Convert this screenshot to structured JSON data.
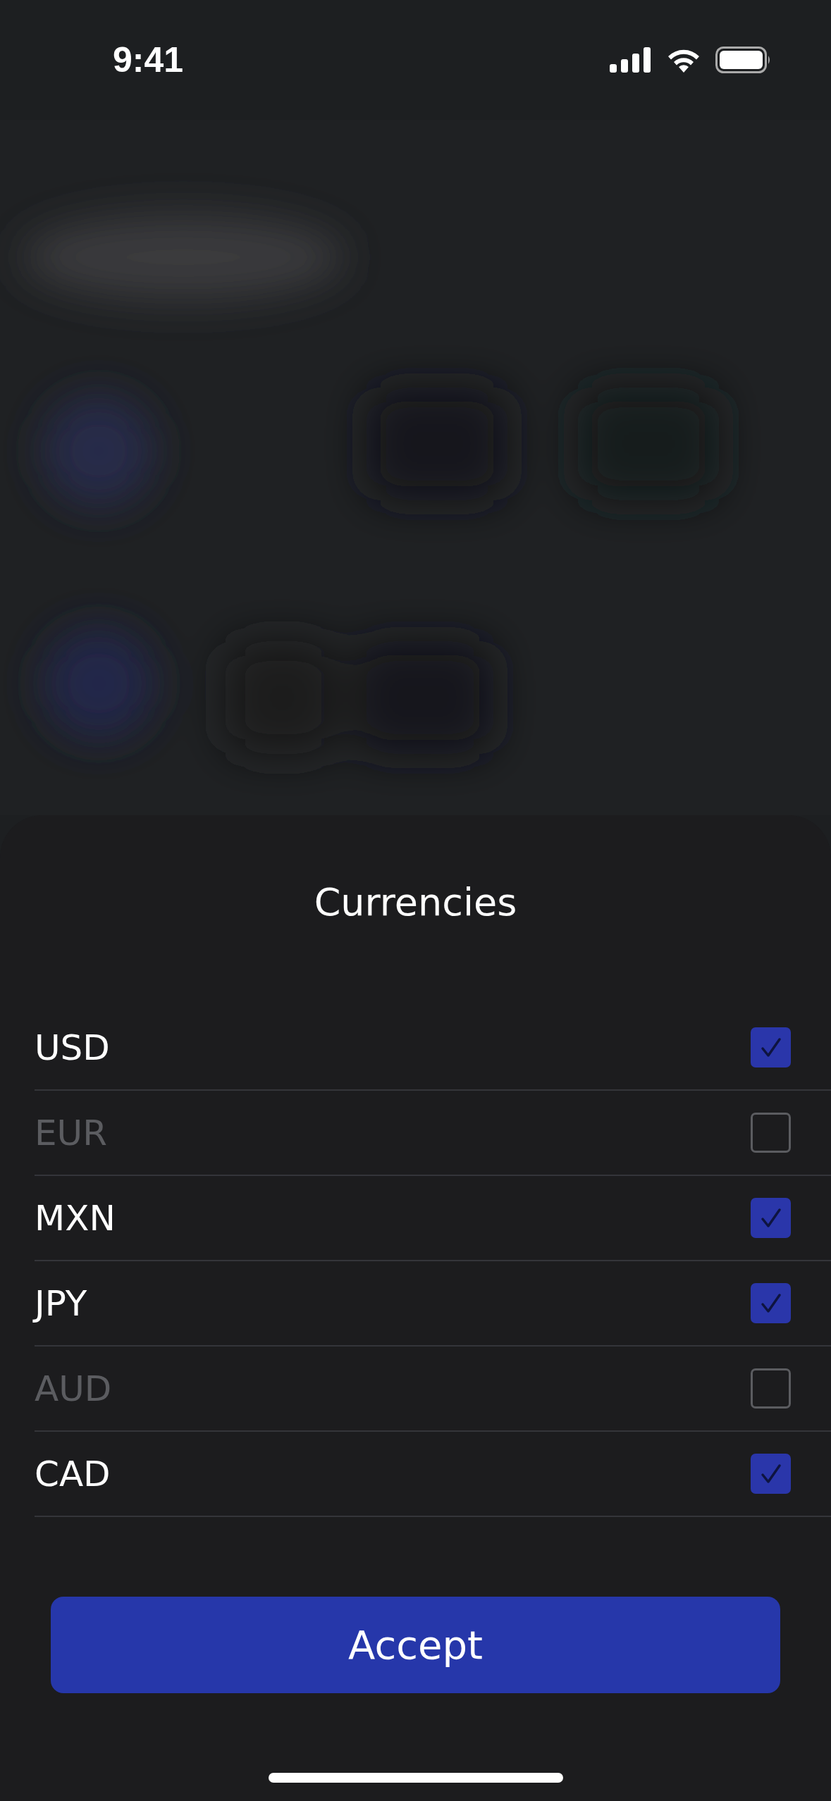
{
  "status_bar": {
    "time": "9:41"
  },
  "sheet": {
    "title": "Currencies",
    "items": [
      {
        "label": "USD",
        "checked": true
      },
      {
        "label": "EUR",
        "checked": false
      },
      {
        "label": "MXN",
        "checked": true
      },
      {
        "label": "JPY",
        "checked": true
      },
      {
        "label": "AUD",
        "checked": false
      },
      {
        "label": "CAD",
        "checked": true
      }
    ],
    "button": "Accept"
  }
}
